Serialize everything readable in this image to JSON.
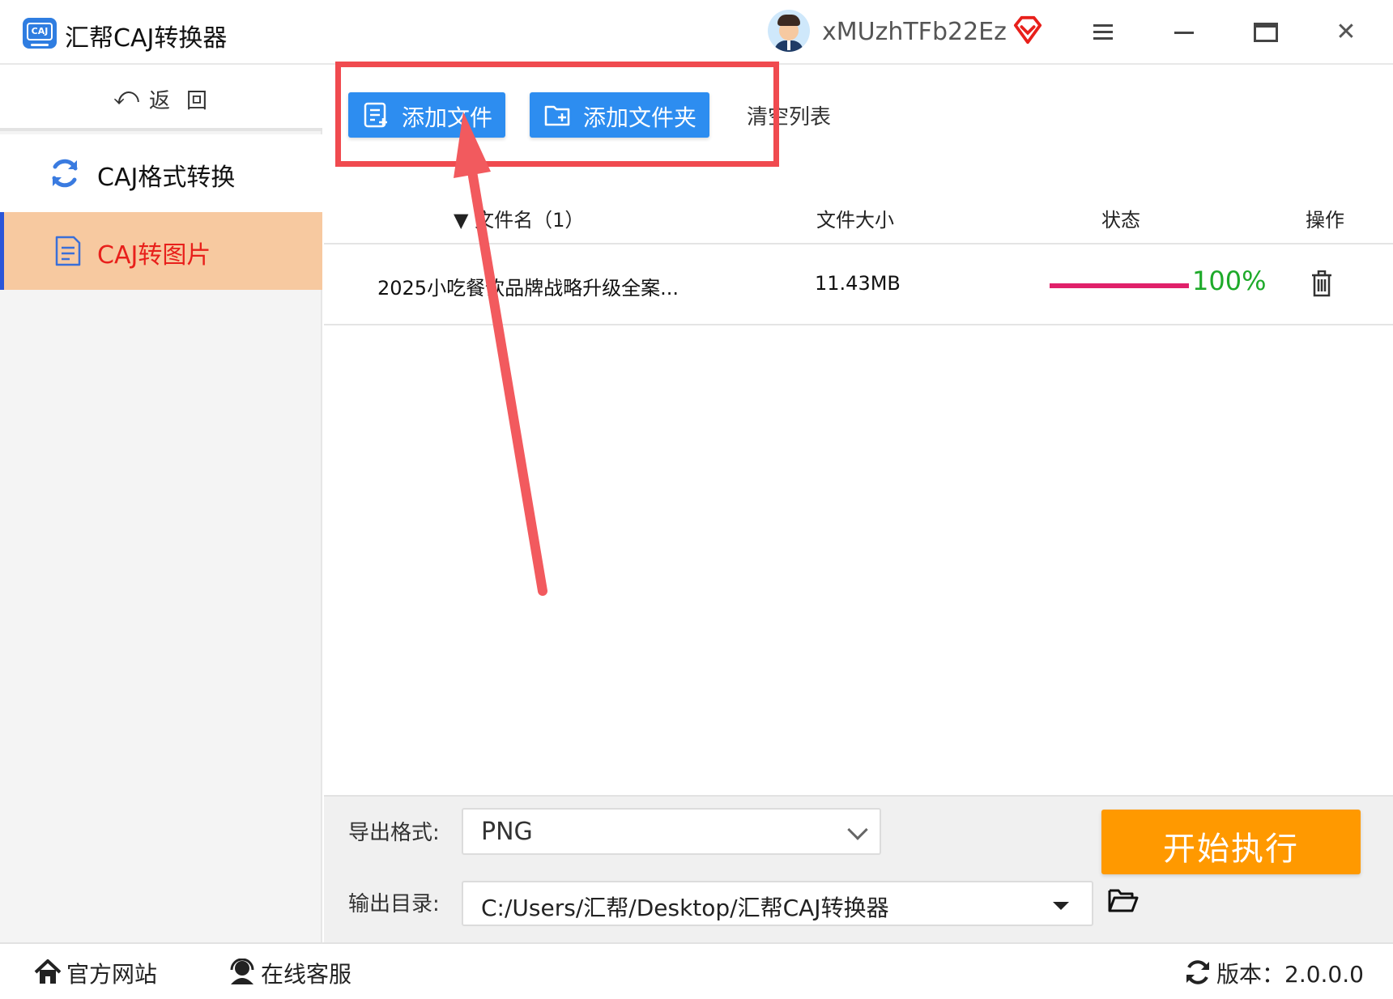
{
  "app": {
    "title": "汇帮CAJ转换器",
    "logo_text": "CAJ"
  },
  "user": {
    "name": "xMUzhTFb22Ez"
  },
  "window_controls": {
    "menu": "menu-icon",
    "minimize": "minimize-icon",
    "maximize": "maximize-icon",
    "close": "close-icon"
  },
  "sidebar": {
    "back": {
      "glyph": "⤺",
      "label": "返回"
    },
    "items": [
      {
        "label": "CAJ格式转换",
        "icon": "refresh-icon",
        "active": false
      },
      {
        "label": "CAJ转图片",
        "icon": "document-icon",
        "active": true
      }
    ]
  },
  "toolbar": {
    "add_file": "添加文件",
    "add_folder": "添加文件夹",
    "clear_list": "清空列表"
  },
  "table": {
    "headers": {
      "name": "文件名（1）",
      "size": "文件大小",
      "status": "状态",
      "operation": "操作"
    },
    "rows": [
      {
        "name": "2025小吃餐饮品牌战略升级全案...",
        "size": "11.43MB",
        "progress": 1.0,
        "progress_text": "100%"
      }
    ]
  },
  "settings": {
    "format_label": "导出格式:",
    "format_value": "PNG",
    "dir_label": "输出目录:",
    "dir_value": "C:/Users/汇帮/Desktop/汇帮CAJ转换器",
    "start": "开始执行"
  },
  "statusbar": {
    "site": "官方网站",
    "service": "在线客服",
    "version": "版本：2.0.0.0"
  },
  "colors": {
    "primary_blue": "#2d8df0",
    "start_orange": "#ff9900",
    "active_nav_bg": "#f7c9a0",
    "active_nav_text": "#e8201b",
    "progress": "#e0206a",
    "progress_text": "#1eaa2a",
    "annotation_red": "#f04a4f"
  }
}
